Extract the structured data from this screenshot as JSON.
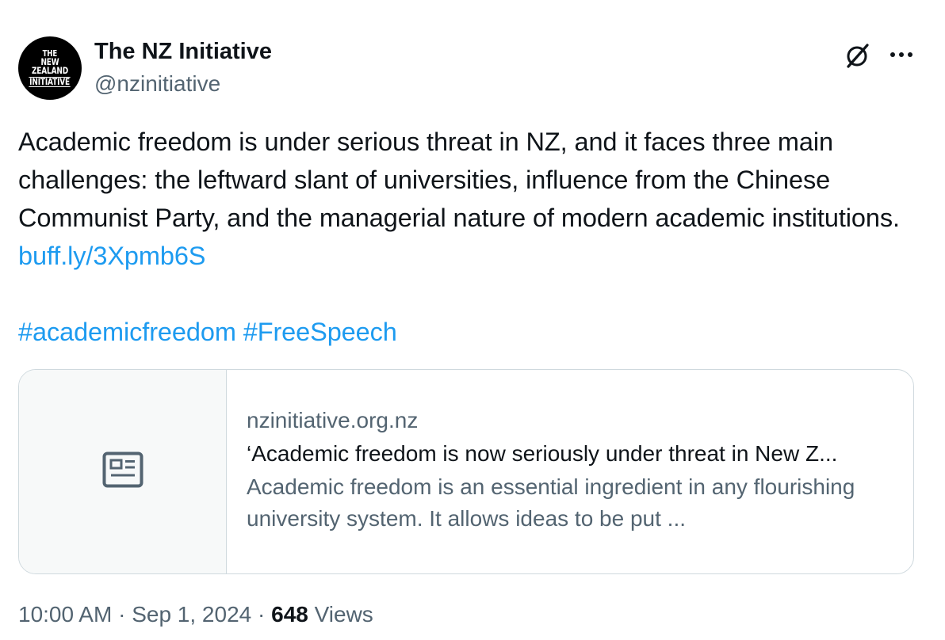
{
  "author": {
    "avatar_lines": [
      "THE",
      "NEW ZEALAND",
      "INITIATIVE"
    ],
    "display_name": "The NZ Initiative",
    "handle": "@nzinitiative"
  },
  "header_icons": {
    "grok": "grok-slash-circle-icon",
    "more": "more-horizontal-icon"
  },
  "tweet": {
    "text_main": "Academic freedom is under serious threat in NZ, and it faces three main challenges: the leftward slant of universities, influence from the Chinese Communist Party, and the managerial nature of modern academic institutions.",
    "link": "buff.ly/3Xpmb6S",
    "hashtag_1": "#academicfreedom",
    "hashtag_2": "#FreeSpeech"
  },
  "card": {
    "icon": "news-article-icon",
    "domain": "nzinitiative.org.nz",
    "title": "‘Academic freedom is now seriously under threat in New Z...",
    "description": "Academic freedom is an essential ingredient in any flourishing university system. It allows ideas to be put ..."
  },
  "meta": {
    "time": "10:00 AM",
    "sep1": " · ",
    "date": "Sep 1, 2024",
    "sep2": " · ",
    "views_count": "648",
    "views_label": " Views"
  },
  "colors": {
    "text": "#0f1419",
    "secondary": "#536471",
    "link": "#1d9bf0",
    "border": "#cfd9de",
    "card_media_bg": "#f7f9f9"
  }
}
